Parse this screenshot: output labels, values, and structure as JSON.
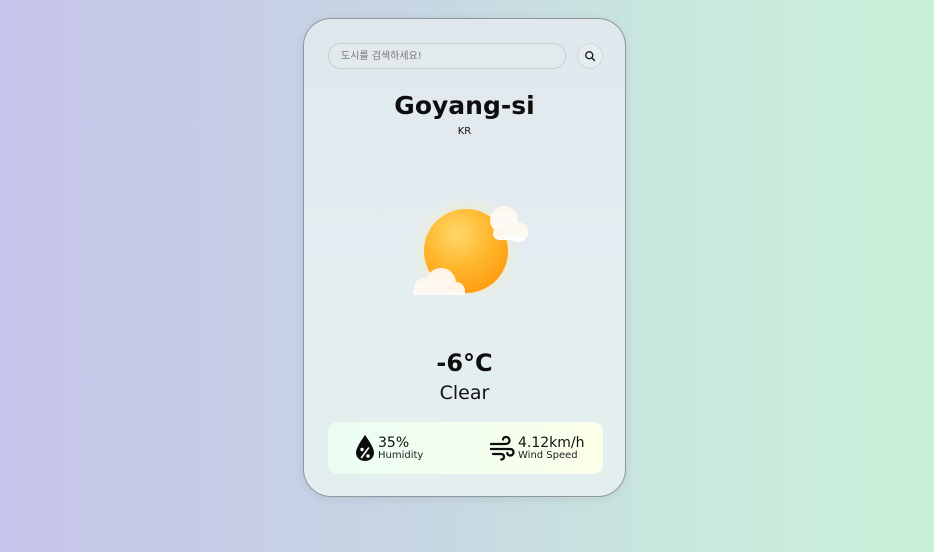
{
  "search": {
    "placeholder": "도시를 검색하세요!",
    "value": ""
  },
  "icons": {
    "search_button": "search-icon",
    "weather": "sun-behind-clouds-icon",
    "humidity": "water-drop-percent-icon",
    "wind": "wind-icon"
  },
  "location": {
    "city": "Goyang-si",
    "country": "KR"
  },
  "weather": {
    "temperature": "-6°C",
    "description": "Clear"
  },
  "stats": {
    "humidity_value": "35%",
    "humidity_label": "Humidity",
    "wind_value": "4.12km/h",
    "wind_label": "Wind Speed"
  }
}
